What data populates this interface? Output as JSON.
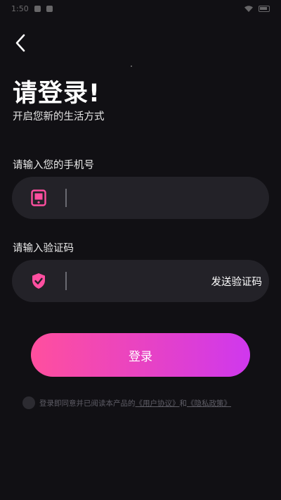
{
  "status_bar": {
    "time": "1:50"
  },
  "nav": {
    "back_icon": "chevron-left-icon"
  },
  "title": "请登录!",
  "subtitle": "开启您新的生活方式",
  "phone": {
    "label": "请输入您的手机号",
    "value": "",
    "placeholder": "",
    "icon": "phone-icon",
    "icon_color": "#ff4fa0"
  },
  "code": {
    "label": "请输入验证码",
    "value": "",
    "placeholder": "",
    "icon": "shield-check-icon",
    "icon_color": "#ff4fa0",
    "send_label": "发送验证码"
  },
  "login_button": {
    "label": "登录",
    "gradient_start": "#ff4f9e",
    "gradient_end": "#cf38ee"
  },
  "agreement": {
    "checked": false,
    "prefix": "登录即同意并已阅读本产品的",
    "user_agreement": "《用户协议》",
    "conjunction": "和",
    "privacy_policy": "《隐私政策》"
  },
  "colors": {
    "background": "#111014",
    "field_background": "#232228",
    "accent": "#ff4fa0"
  }
}
